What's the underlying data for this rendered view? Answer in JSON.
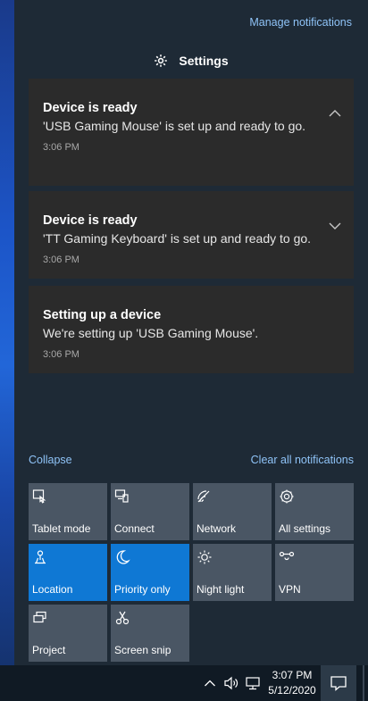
{
  "header": {
    "manage_link": "Manage notifications",
    "settings_label": "Settings",
    "settings_icon": "gear-icon"
  },
  "notifications": [
    {
      "title": "Device is ready",
      "body": "'USB Gaming Mouse' is set up and ready to go.",
      "time": "3:06 PM",
      "chevron": "chevron-up-icon"
    },
    {
      "title": "Device is ready",
      "body": "'TT   Gaming Keyboard' is set up and ready to go.",
      "time": "3:06 PM",
      "chevron": "chevron-down-icon"
    },
    {
      "title": "Setting up a device",
      "body": "We're setting up 'USB Gaming Mouse'.",
      "time": "3:06 PM"
    }
  ],
  "links": {
    "collapse": "Collapse",
    "clear_all": "Clear all notifications"
  },
  "quick_actions": [
    {
      "label": "Tablet mode",
      "icon": "tablet-mode-icon",
      "active": false
    },
    {
      "label": "Connect",
      "icon": "connect-icon",
      "active": false
    },
    {
      "label": "Network",
      "icon": "network-icon",
      "active": false
    },
    {
      "label": "All settings",
      "icon": "gear-icon",
      "active": false
    },
    {
      "label": "Location",
      "icon": "location-icon",
      "active": true
    },
    {
      "label": "Priority only",
      "icon": "moon-icon",
      "active": true
    },
    {
      "label": "Night light",
      "icon": "brightness-icon",
      "active": false
    },
    {
      "label": "VPN",
      "icon": "vpn-icon",
      "active": false
    },
    {
      "label": "Project",
      "icon": "project-icon",
      "active": false
    },
    {
      "label": "Screen snip",
      "icon": "screen-snip-icon",
      "active": false
    }
  ],
  "taskbar": {
    "time": "3:07 PM",
    "date": "5/12/2020"
  },
  "colors": {
    "accent": "#0f78d4",
    "link": "#8fc3f7",
    "panel": "#1e2a36",
    "tile": "#4a5664",
    "notification_bg": "#2b2b2b"
  }
}
